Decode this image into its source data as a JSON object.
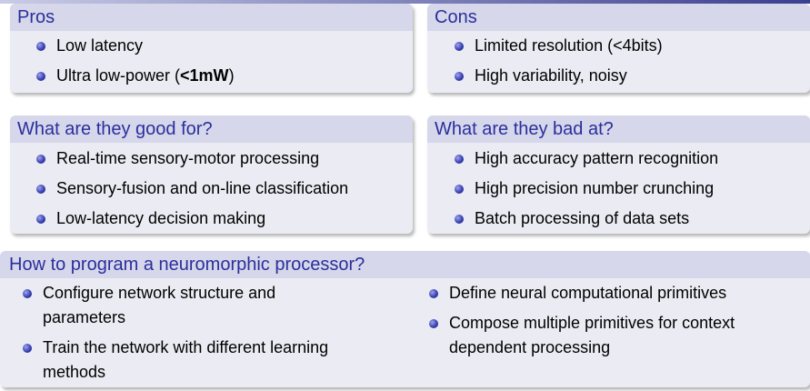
{
  "pros": {
    "title": "Pros",
    "items": [
      "Low latency"
    ],
    "item2_prefix": "Ultra low-power (",
    "item2_bold": "<1mW",
    "item2_suffix": ")"
  },
  "cons": {
    "title": "Cons",
    "items": [
      "Limited resolution (<4bits)",
      "High variability, noisy"
    ]
  },
  "good": {
    "title": "What are they good for?",
    "items": [
      "Real-time sensory-motor processing",
      "Sensory-fusion and on-line classification",
      "Low-latency decision making"
    ]
  },
  "bad": {
    "title": "What are they bad at?",
    "items": [
      "High accuracy pattern recognition",
      "High precision number crunching",
      "Batch processing of data sets"
    ]
  },
  "program": {
    "title": "How to program a neuromorphic processor?",
    "left_items": [
      {
        "line1": "Configure network structure and",
        "line2": "parameters"
      },
      {
        "line1": "Train the network with different learning",
        "line2": "methods"
      }
    ],
    "right_items": [
      {
        "line1": "Define neural computational primitives",
        "line2": ""
      },
      {
        "line1": "Compose multiple primitives for context",
        "line2": "dependent processing"
      }
    ]
  }
}
